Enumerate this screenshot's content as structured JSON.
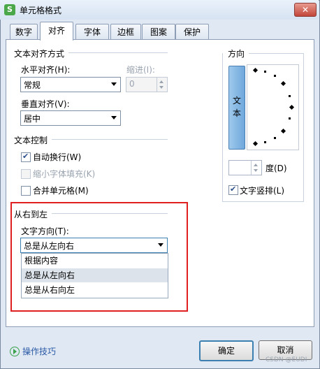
{
  "window": {
    "title": "单元格格式",
    "app_icon": "S",
    "close_glyph": "✕"
  },
  "tabs": [
    {
      "label": "数字"
    },
    {
      "label": "对齐"
    },
    {
      "label": "字体"
    },
    {
      "label": "边框"
    },
    {
      "label": "图案"
    },
    {
      "label": "保护"
    }
  ],
  "text_align": {
    "group_title": "文本对齐方式",
    "horizontal_label": "水平对齐(H):",
    "horizontal_value": "常规",
    "indent_label": "缩进(I):",
    "indent_value": "0",
    "vertical_label": "垂直对齐(V):",
    "vertical_value": "居中"
  },
  "text_control": {
    "group_title": "文本控制",
    "wrap_label": "自动换行(W)",
    "wrap_checked": true,
    "shrink_label": "缩小字体填充(K)",
    "merge_label": "合并单元格(M)"
  },
  "rtl": {
    "group_title": "从右到左",
    "direction_label": "文字方向(T):",
    "direction_value": "总是从左向右",
    "options": [
      "根据内容",
      "总是从左向右",
      "总是从右向左"
    ]
  },
  "orientation": {
    "group_title": "方向",
    "vertical_text_glyph_1": "文",
    "vertical_text_glyph_2": "本",
    "degree_value": "",
    "degree_label": "度(D)",
    "vertical_checkbox_label": "文字竖排(L)",
    "vertical_checked": true
  },
  "footer": {
    "tips_label": "操作技巧",
    "ok_label": "确定",
    "cancel_label": "取消",
    "watermark": "CSDN @EUDI"
  },
  "colors": {
    "highlight_frame": "#e02020",
    "link": "#2b59a5",
    "accent": "#3c7fb1"
  }
}
